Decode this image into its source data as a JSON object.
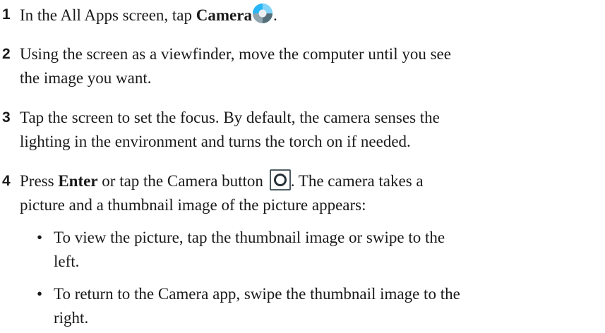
{
  "steps": [
    {
      "number": "1",
      "lines": [
        "In the All Apps screen, tap "
      ],
      "bold": "Camera",
      "after_icon": ".",
      "icon": "camera-app-icon"
    },
    {
      "number": "2",
      "lines": [
        "Using the screen as a viewfinder, move the computer until you see",
        "the image you want."
      ]
    },
    {
      "number": "3",
      "lines": [
        "Tap the screen to set the focus. By default, the camera senses the",
        "lighting in the environment and turns the torch on if needed."
      ]
    },
    {
      "number": "4",
      "prefix": "Press ",
      "bold": "Enter",
      "middle": " or tap the Camera button ",
      "after_icon": ". The camera takes a",
      "line2": "picture and a thumbnail image of the picture appears:",
      "icon": "camera-button-icon"
    }
  ],
  "bullets": [
    {
      "symbol": "•",
      "lines": [
        "To view the picture, tap the thumbnail image or swipe to the",
        "left."
      ]
    },
    {
      "symbol": "•",
      "lines": [
        "To return to the Camera app, swipe the thumbnail image to the",
        "right."
      ]
    }
  ]
}
